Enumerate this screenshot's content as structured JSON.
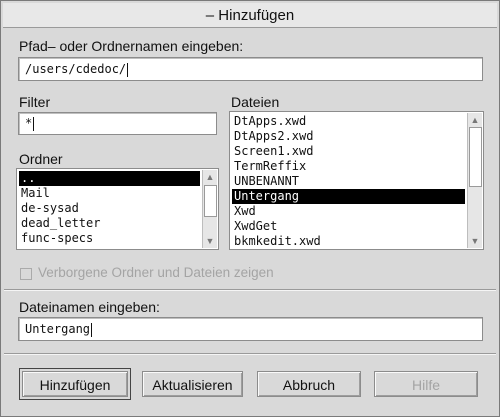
{
  "window": {
    "title": "– Hinzufügen"
  },
  "path": {
    "label": "Pfad– oder Ordnernamen eingeben:",
    "value": "/users/cdedoc/"
  },
  "filter": {
    "label": "Filter",
    "value": "*"
  },
  "folders": {
    "label": "Ordner",
    "items": [
      "..",
      "Mail",
      "de-sysad",
      "dead_letter",
      "func-specs"
    ],
    "selected_index": 0
  },
  "files": {
    "label": "Dateien",
    "items": [
      "DtApps.xwd",
      "DtApps2.xwd",
      "Screen1.xwd",
      "TermReffix",
      "UNBENANNT",
      "Untergang",
      "Xwd",
      "XwdGet",
      "bkmkedit.xwd"
    ],
    "selected_index": 5
  },
  "options": {
    "show_hidden_label": "Verborgene Ordner und Dateien zeigen",
    "show_hidden_checked": false
  },
  "filename": {
    "label": "Dateinamen eingeben:",
    "value": "Untergang"
  },
  "buttons": {
    "add": "Hinzufügen",
    "update": "Aktualisieren",
    "cancel": "Abbruch",
    "help": "Hilfe"
  }
}
